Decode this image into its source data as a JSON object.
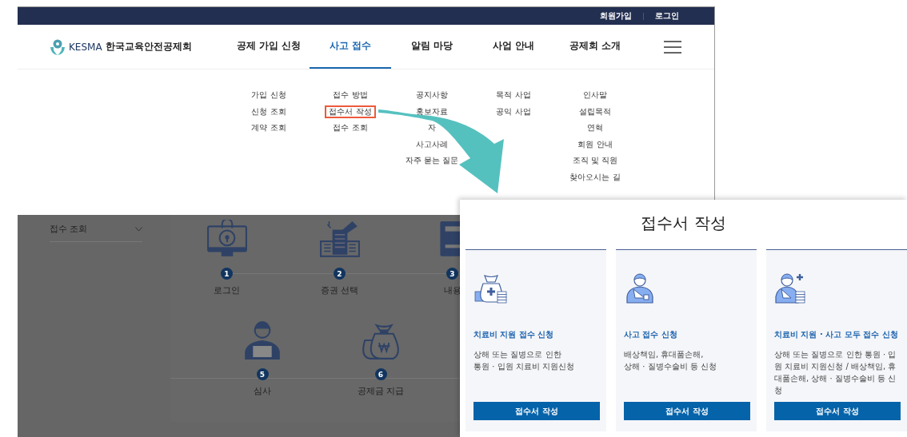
{
  "top_bar": {
    "links": [
      "회원가입",
      "로그인"
    ]
  },
  "header": {
    "logo_text": "KESMA",
    "org_name": "한국교육안전공제회",
    "nav": [
      {
        "label": "공제 가입 신청",
        "selected": false
      },
      {
        "label": "사고 접수",
        "selected": true
      },
      {
        "label": "알림 마당",
        "selected": false
      },
      {
        "label": "사업 안내",
        "selected": false
      },
      {
        "label": "공제회 소개",
        "selected": false
      }
    ]
  },
  "mega_menu": {
    "columns": [
      {
        "items": [
          {
            "label": "가입 신청",
            "highlighted": false
          },
          {
            "label": "신청 조회",
            "highlighted": false
          },
          {
            "label": "계약 조회",
            "highlighted": false
          }
        ]
      },
      {
        "items": [
          {
            "label": "접수 방법",
            "highlighted": false
          },
          {
            "label": "접수서 작성",
            "highlighted": true
          },
          {
            "label": "접수 조회",
            "highlighted": false
          }
        ]
      },
      {
        "items": [
          {
            "label": "공지사항",
            "highlighted": false
          },
          {
            "label": "홍보자료",
            "highlighted": false
          },
          {
            "label": "자",
            "highlighted": false
          },
          {
            "label": "사고사례",
            "highlighted": false
          },
          {
            "label": "자주 묻는 질문",
            "highlighted": false
          }
        ]
      },
      {
        "items": [
          {
            "label": "목적 사업",
            "highlighted": false
          },
          {
            "label": "공익 사업",
            "highlighted": false
          }
        ]
      },
      {
        "items": [
          {
            "label": "인사말",
            "highlighted": false
          },
          {
            "label": "설립목적",
            "highlighted": false
          },
          {
            "label": "연혁",
            "highlighted": false
          },
          {
            "label": "회원 안내",
            "highlighted": false
          },
          {
            "label": "조직 및 직원",
            "highlighted": false
          },
          {
            "label": "찾아오시는 길",
            "highlighted": false
          }
        ]
      }
    ]
  },
  "sidebar": {
    "dropdown": "접수 조회"
  },
  "steps": [
    [
      {
        "kind": "login",
        "number": "1",
        "label": "로그인"
      },
      {
        "kind": "select",
        "number": "2",
        "label": "증권 선택"
      },
      {
        "kind": "content",
        "number": "3",
        "label": "내용"
      }
    ],
    [
      {
        "kind": "review",
        "number": "5",
        "label": "심사"
      },
      {
        "kind": "payment",
        "number": "6",
        "label": "공제금 지급"
      }
    ]
  ],
  "popup": {
    "title": "접수서 작성",
    "cards": [
      {
        "kind": "money",
        "title": "치료비 지원 접수 신청",
        "description": [
          "상해 또는 질병으로 인한",
          "통원 · 입원 치료비 지원신청"
        ],
        "button": "접수서 작성"
      },
      {
        "kind": "injured",
        "title": "사고 접수 신청",
        "description": [
          "배상책임, 휴대품손해,",
          "상해 · 질병수술비 등 신청"
        ],
        "button": "접수서 작성"
      },
      {
        "kind": "both",
        "title": "치료비 지원 · 사고 모두 접수 신청",
        "description": [
          "상해 또는 질병으로 인한 통원 · 입원 치료비 지원신청 / 배상책임, 휴대품손해, 상해 · 질병수술비 등 신청"
        ],
        "button": "접수서 작성"
      }
    ]
  }
}
